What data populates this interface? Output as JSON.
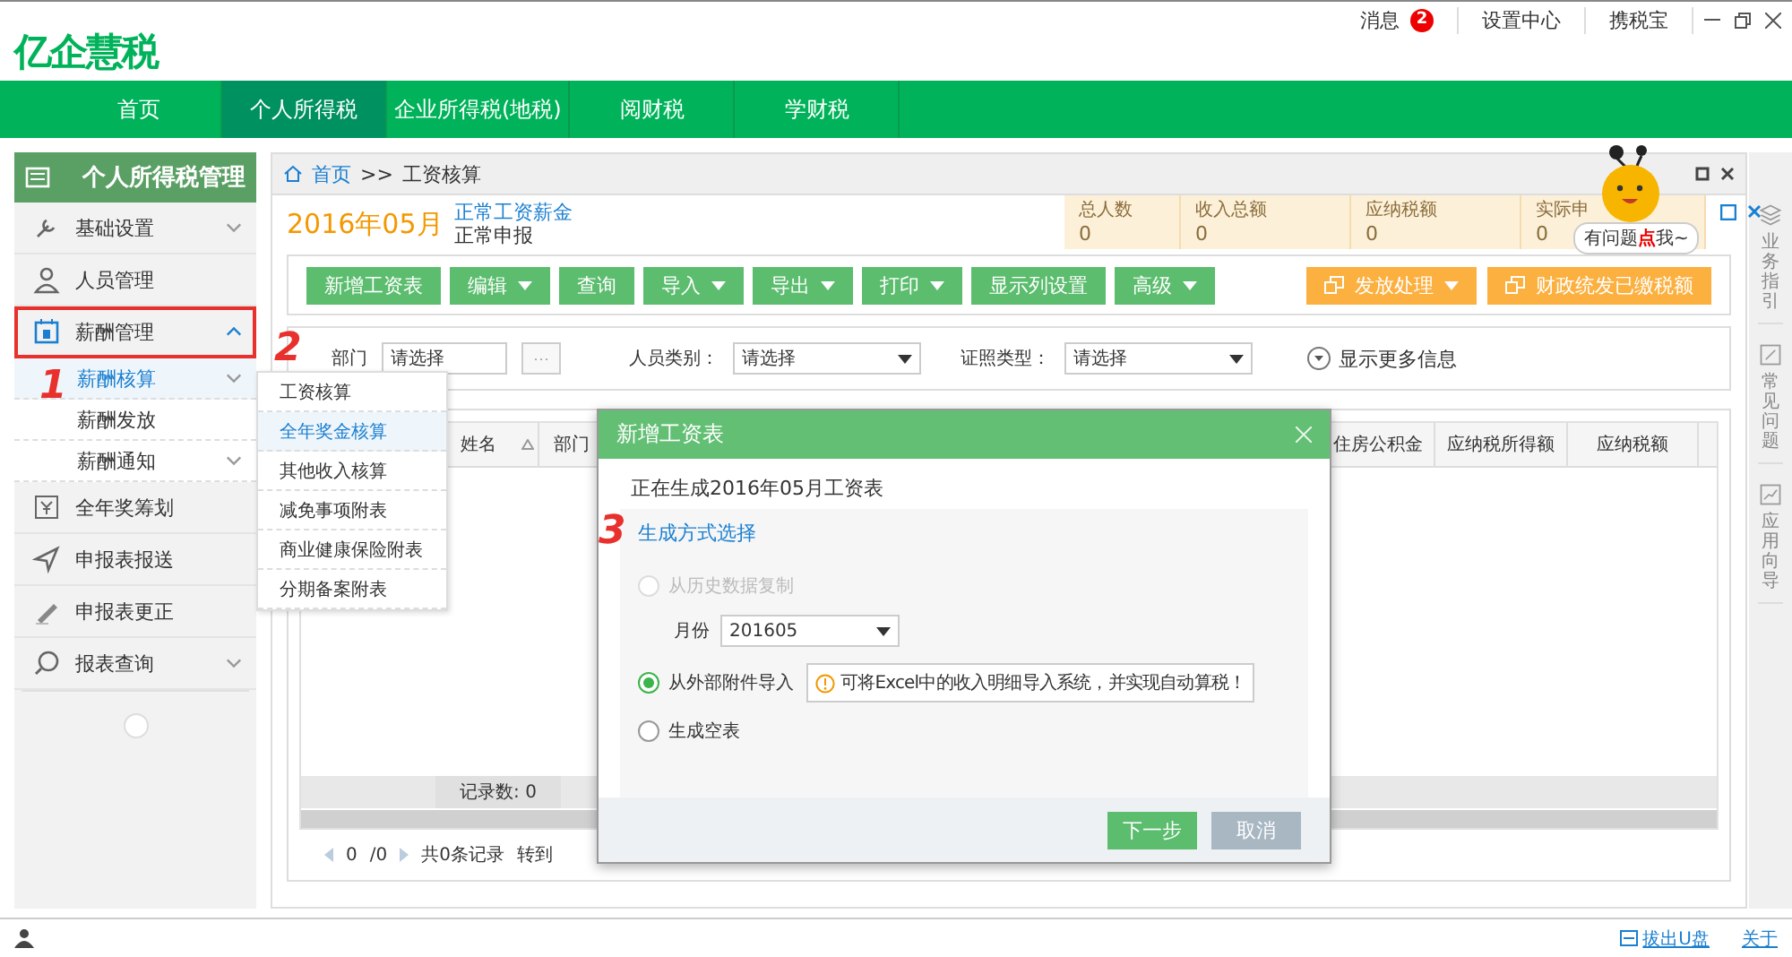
{
  "app": {
    "logo": "亿企慧税",
    "header_links": [
      {
        "label": "消息",
        "badge": "2"
      },
      {
        "label": "设置中心"
      },
      {
        "label": "携税宝"
      }
    ]
  },
  "nav": [
    {
      "label": "首页",
      "selected": false
    },
    {
      "label": "个人所得税",
      "selected": true
    },
    {
      "label": "企业所得税(地税)",
      "selected": false
    },
    {
      "label": "阅财税",
      "selected": false
    },
    {
      "label": "学财税",
      "selected": false
    }
  ],
  "sidebar": {
    "title": "个人所得税管理",
    "items": [
      {
        "label": "基础设置",
        "kind": "wrench",
        "expandable": true,
        "expanded": false,
        "annotated": false
      },
      {
        "label": "人员管理",
        "kind": "person",
        "expandable": false,
        "annotated": false
      },
      {
        "label": "薪酬管理",
        "kind": "calendar",
        "expandable": true,
        "expanded": true,
        "annotated": true,
        "children": [
          {
            "label": "薪酬核算",
            "selected": true,
            "expandable": true
          },
          {
            "label": "薪酬发放",
            "selected": false,
            "expandable": false
          },
          {
            "label": "薪酬通知",
            "selected": false,
            "expandable": true
          }
        ]
      },
      {
        "label": "全年奖筹划",
        "kind": "yen",
        "expandable": false,
        "annotated": false
      },
      {
        "label": "申报表报送",
        "kind": "send",
        "expandable": false,
        "annotated": false
      },
      {
        "label": "申报表更正",
        "kind": "pen",
        "expandable": false,
        "annotated": false
      },
      {
        "label": "报表查询",
        "kind": "search",
        "expandable": true,
        "expanded": false,
        "annotated": false
      }
    ]
  },
  "breadcrumb": {
    "items": [
      "首页",
      "工资核算"
    ],
    "separator": ">>"
  },
  "header": {
    "period": "2016年05月",
    "type": "正常工资薪金",
    "subtype": "正常申报"
  },
  "summary": [
    {
      "label": "总人数",
      "value": "0"
    },
    {
      "label": "收入总额",
      "value": "0"
    },
    {
      "label": "应纳税额",
      "value": "0"
    },
    {
      "label": "实际申",
      "value": "0"
    }
  ],
  "toolbar": [
    {
      "label": "新增工资表",
      "dropdown": false
    },
    {
      "label": "编辑",
      "dropdown": true
    },
    {
      "label": "查询",
      "dropdown": false
    },
    {
      "label": "导入",
      "dropdown": true
    },
    {
      "label": "导出",
      "dropdown": true
    },
    {
      "label": "打印",
      "dropdown": true
    },
    {
      "label": "显示列设置",
      "dropdown": false
    },
    {
      "label": "高级",
      "dropdown": true
    }
  ],
  "toolbar_right": [
    {
      "label": "发放处理",
      "dropdown": true
    },
    {
      "label": "财政统发已缴税额",
      "dropdown": false
    }
  ],
  "filters": [
    {
      "label": "部门",
      "value": "请选择",
      "kind": "picker",
      "button": "···"
    },
    {
      "label": "人员类别：",
      "value": "请选择",
      "kind": "select"
    },
    {
      "label": "证照类型：",
      "value": "请选择",
      "kind": "select"
    }
  ],
  "more_info": "显示更多信息",
  "table": {
    "columns": [
      {
        "label": "姓名",
        "sortable": true
      },
      {
        "label": "部门"
      },
      {
        "label": "住房公积金"
      },
      {
        "label": "应纳税所得额"
      },
      {
        "label": "应纳税额"
      }
    ],
    "record_count": "记录数: 0"
  },
  "pagination": {
    "page": "0",
    "total_pages": "/0",
    "records": "共0条记录",
    "goto": "转到"
  },
  "right_strip": [
    {
      "label": "业务指引",
      "kind": "layers"
    },
    {
      "label": "常见问题",
      "kind": "edit"
    },
    {
      "label": "应用向导",
      "kind": "chart"
    }
  ],
  "mascot": {
    "bubble": "有问题**点**我~"
  },
  "flyout_menu": [
    {
      "label": "工资核算",
      "selected": false
    },
    {
      "label": "全年奖金核算",
      "selected": true
    },
    {
      "label": "其他收入核算",
      "selected": false
    },
    {
      "label": "减免事项附表",
      "selected": false
    },
    {
      "label": "商业健康保险附表",
      "selected": false
    },
    {
      "label": "分期备案附表",
      "selected": false
    }
  ],
  "dialog": {
    "title": "新增工资表",
    "heading": "正在生成2016年05月工资表",
    "section": "生成方式选择",
    "options": [
      {
        "label": "从历史数据复制",
        "selected": false,
        "disabled": true
      },
      {
        "label": "从外部附件导入",
        "selected": true,
        "disabled": false,
        "hint": "可将Excel中的收入明细导入系统，并实现自动算税！"
      },
      {
        "label": "生成空表",
        "selected": false,
        "disabled": false
      }
    ],
    "month": {
      "label": "月份",
      "value": "201605"
    },
    "buttons": [
      {
        "label": "下一步",
        "kind": "primary"
      },
      {
        "label": "取消",
        "kind": "secondary"
      }
    ]
  },
  "status_bar": {
    "links": [
      "拔出U盘",
      "关于"
    ]
  },
  "annotations": [
    {
      "text": "1"
    },
    {
      "text": "2"
    },
    {
      "text": "3"
    }
  ]
}
